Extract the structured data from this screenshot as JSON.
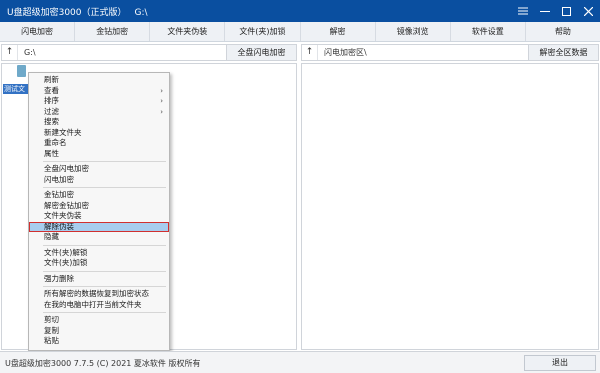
{
  "window": {
    "title": "U盘超级加密3000（正式版）",
    "path": "G:\\",
    "controls": [
      {
        "name": "menu-icon",
        "glyph": "≡"
      },
      {
        "name": "minimize-icon",
        "glyph": "—"
      },
      {
        "name": "maximize-icon",
        "glyph": "☐"
      },
      {
        "name": "close-icon",
        "glyph": "✕"
      }
    ]
  },
  "toolbar": {
    "buttons": [
      "闪电加密",
      "金钻加密",
      "文件夹伪装",
      "文件(夹)加锁",
      "解密",
      "镜像浏览",
      "软件设置",
      "帮助"
    ]
  },
  "left": {
    "up_glyph": "↑",
    "path": "G:\\",
    "button": "全盘闪电加密",
    "file": {
      "name": "测试文件夹",
      "label": "测试文"
    }
  },
  "right": {
    "up_glyph": "↑",
    "path": "闪电加密区\\",
    "button": "解密全区数据"
  },
  "context_menu": {
    "groups": [
      [
        {
          "label": "刷新"
        },
        {
          "label": "查看",
          "submenu": true
        },
        {
          "label": "排序",
          "submenu": true
        },
        {
          "label": "过滤",
          "submenu": true
        },
        {
          "label": "搜索"
        },
        {
          "label": "新建文件夹"
        },
        {
          "label": "重命名"
        },
        {
          "label": "属性"
        }
      ],
      [
        {
          "label": "全盘闪电加密"
        },
        {
          "label": "闪电加密"
        }
      ],
      [
        {
          "label": "金钻加密"
        },
        {
          "label": "解密金钻加密"
        },
        {
          "label": "文件夹伪装"
        },
        {
          "label": "解除伪装",
          "highlight": true
        },
        {
          "label": "隐藏"
        }
      ],
      [
        {
          "label": "文件(夹)解锁"
        },
        {
          "label": "文件(夹)加锁"
        }
      ],
      [
        {
          "label": "强力删除"
        }
      ],
      [
        {
          "label": "所有解密的数据恢复到加密状态"
        },
        {
          "label": "在我的电脑中打开当前文件夹"
        }
      ],
      [
        {
          "label": "剪切"
        },
        {
          "label": "复制"
        },
        {
          "label": "粘贴"
        }
      ]
    ],
    "submenu_glyph": "›"
  },
  "status": {
    "text": "U盘超级加密3000  7.7.5  (C)  2021  夏冰软件 版权所有",
    "exit": "退出"
  },
  "colors": {
    "titlebar": "#0a4fa0",
    "highlight": "#a7cdee",
    "highlight_border": "#d03030",
    "selection": "#3372c4"
  }
}
